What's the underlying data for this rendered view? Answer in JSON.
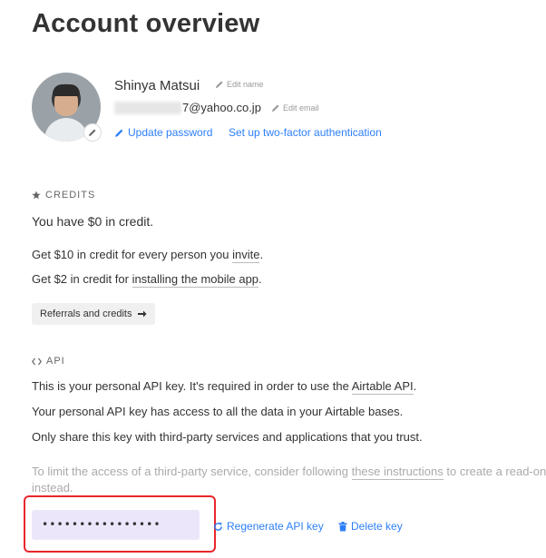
{
  "page": {
    "title": "Account overview"
  },
  "profile": {
    "name": "Shinya Matsui",
    "edit_name_label": "Edit name",
    "email_visible": "7@yahoo.co.jp",
    "edit_email_label": "Edit email",
    "update_password_label": "Update password",
    "two_factor_label": "Set up two-factor authentication"
  },
  "credits": {
    "heading": "CREDITS",
    "balance_text": "You have $0 in credit.",
    "invite_prefix": "Get $10 in credit for every person you ",
    "invite_link": "invite",
    "invite_suffix": ".",
    "mobile_prefix": "Get $2 in credit for ",
    "mobile_link": "installing the mobile app",
    "mobile_suffix": ".",
    "referrals_button": "Referrals and credits"
  },
  "api": {
    "heading": "API",
    "line1_prefix": "This is your personal API key. It's required in order to use the ",
    "line1_link": "Airtable API",
    "line1_suffix": ".",
    "line2": "Your personal API key has access to all the data in your Airtable bases.",
    "line3": "Only share this key with third-party services and applications that you trust.",
    "limit_prefix": "To limit the access of a third-party service, consider following ",
    "limit_link": "these instructions",
    "limit_suffix": " to create a read-only",
    "limit_line2": "instead.",
    "key_masked": "••••••••••••••••",
    "regenerate_label": "Regenerate API key",
    "delete_label": "Delete key"
  },
  "icons": {
    "pencil": "pencil-icon",
    "star": "star-icon",
    "code": "code-icon",
    "arrow": "arrow-right-icon",
    "refresh": "refresh-icon",
    "trash": "trash-icon"
  },
  "colors": {
    "link": "#2d7ff9",
    "key_field": "#ece6fb",
    "highlight": "#e8262c"
  }
}
